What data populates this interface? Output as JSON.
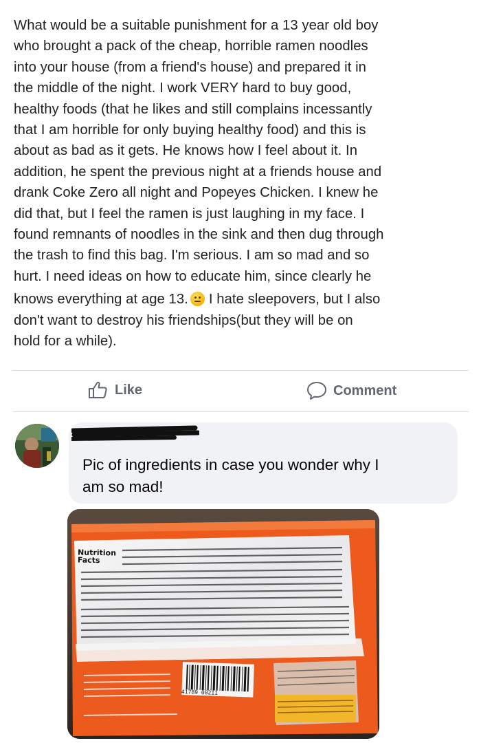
{
  "post": {
    "lines": [
      "What would be a suitable punishment for a 13 year old boy",
      "who brought a pack of the cheap, horrible ramen noodles",
      "into your house (from a friend's house) and prepared it in",
      "the middle of the night. I work VERY hard to buy good,",
      "healthy foods (that he likes and still complains incessantly",
      "that I am horrible for only buying healthy food) and this is",
      "about as bad as it gets. He knows how I feel about it. In",
      "addition, he spent the previous night at a friends house and",
      "drank Coke Zero all night and Popeyes Chicken. I knew he",
      "did that, but I feel the ramen is just laughing in my face. I",
      "found remnants of noodles in the sink and then dug through",
      "the trash to find this bag. I'm serious. I am so mad and so",
      "hurt. I need ideas on how to educate him, since clearly he"
    ],
    "line_with_emoji_before": "knows everything at age 13.",
    "line_with_emoji_after": "I hate sleepovers, but I also",
    "emoji": "annoyed-face-emoji",
    "tail_lines": [
      "don't want to destroy his friendships(but they will be on",
      "hold for a while)."
    ]
  },
  "actions": {
    "like_label": "Like",
    "comment_label": "Comment",
    "like_icon": "thumbs-up-icon",
    "comment_icon": "speech-bubble-icon"
  },
  "comment": {
    "text_line1": "Pic of ingredients in case you wonder why I",
    "text_line2": "am so mad!",
    "photo": {
      "nutrition_title_1": "Nutrition",
      "nutrition_title_2": "Facts",
      "barcode_number": "41789 00211"
    }
  },
  "colors": {
    "action_text": "#606770",
    "bubble_bg": "#f0f2f5",
    "divider": "#dadde1",
    "package_orange": "#ee5a1c"
  }
}
